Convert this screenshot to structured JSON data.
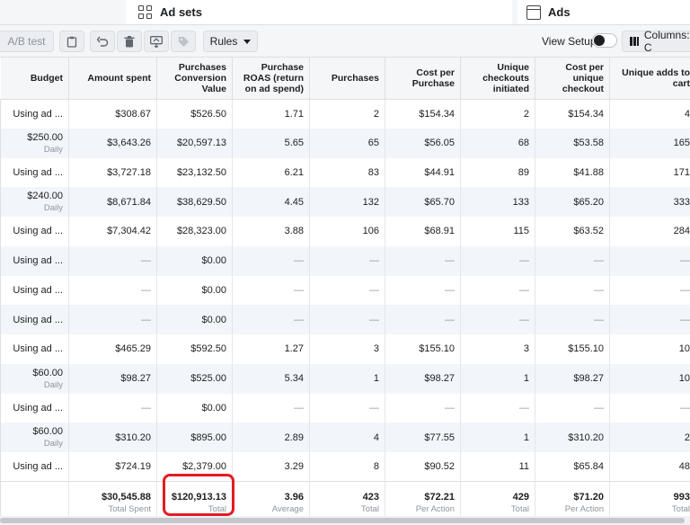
{
  "tabs": {
    "adsets": "Ad sets",
    "ads": "Ads"
  },
  "toolbar": {
    "ab_test": "A/B test",
    "rules": "Rules",
    "view_setup": "View Setup",
    "columns": "Columns: C"
  },
  "columns": [
    "Budget",
    "Amount spent",
    "Purchases Conversion Value",
    "Purchase ROAS (return on ad spend)",
    "Purchases",
    "Cost per Purchase",
    "Unique checkouts initiated",
    "Cost per unique checkout",
    "Unique adds to cart"
  ],
  "rows": [
    {
      "budget": "Using ad ...",
      "budget_sub": "",
      "amount": "$308.67",
      "value": "$526.50",
      "roas": "1.71",
      "purchases": "2",
      "cpp": "$154.34",
      "checkouts": "2",
      "cpc": "$154.34",
      "adds": "4"
    },
    {
      "budget": "$250.00",
      "budget_sub": "Daily",
      "amount": "$3,643.26",
      "value": "$20,597.13",
      "roas": "5.65",
      "purchases": "65",
      "cpp": "$56.05",
      "checkouts": "68",
      "cpc": "$53.58",
      "adds": "165"
    },
    {
      "budget": "Using ad ...",
      "budget_sub": "",
      "amount": "$3,727.18",
      "value": "$23,132.50",
      "roas": "6.21",
      "purchases": "83",
      "cpp": "$44.91",
      "checkouts": "89",
      "cpc": "$41.88",
      "adds": "171"
    },
    {
      "budget": "$240.00",
      "budget_sub": "Daily",
      "amount": "$8,671.84",
      "value": "$38,629.50",
      "roas": "4.45",
      "purchases": "132",
      "cpp": "$65.70",
      "checkouts": "133",
      "cpc": "$65.20",
      "adds": "333"
    },
    {
      "budget": "Using ad ...",
      "budget_sub": "",
      "amount": "$7,304.42",
      "value": "$28,323.00",
      "roas": "3.88",
      "purchases": "106",
      "cpp": "$68.91",
      "checkouts": "115",
      "cpc": "$63.52",
      "adds": "284"
    },
    {
      "budget": "Using ad ...",
      "budget_sub": "",
      "amount": "—",
      "value": "$0.00",
      "roas": "—",
      "purchases": "—",
      "cpp": "—",
      "checkouts": "—",
      "cpc": "—",
      "adds": "—"
    },
    {
      "budget": "Using ad ...",
      "budget_sub": "",
      "amount": "—",
      "value": "$0.00",
      "roas": "—",
      "purchases": "—",
      "cpp": "—",
      "checkouts": "—",
      "cpc": "—",
      "adds": "—"
    },
    {
      "budget": "Using ad ...",
      "budget_sub": "",
      "amount": "—",
      "value": "$0.00",
      "roas": "—",
      "purchases": "—",
      "cpp": "—",
      "checkouts": "—",
      "cpc": "—",
      "adds": "—"
    },
    {
      "budget": "Using ad ...",
      "budget_sub": "",
      "amount": "$465.29",
      "value": "$592.50",
      "roas": "1.27",
      "purchases": "3",
      "cpp": "$155.10",
      "checkouts": "3",
      "cpc": "$155.10",
      "adds": "10"
    },
    {
      "budget": "$60.00",
      "budget_sub": "Daily",
      "amount": "$98.27",
      "value": "$525.00",
      "roas": "5.34",
      "purchases": "1",
      "cpp": "$98.27",
      "checkouts": "1",
      "cpc": "$98.27",
      "adds": "10"
    },
    {
      "budget": "Using ad ...",
      "budget_sub": "",
      "amount": "—",
      "value": "$0.00",
      "roas": "—",
      "purchases": "—",
      "cpp": "—",
      "checkouts": "—",
      "cpc": "—",
      "adds": "—"
    },
    {
      "budget": "$60.00",
      "budget_sub": "Daily",
      "amount": "$310.20",
      "value": "$895.00",
      "roas": "2.89",
      "purchases": "4",
      "cpp": "$77.55",
      "checkouts": "1",
      "cpc": "$310.20",
      "adds": "2"
    },
    {
      "budget": "Using ad ...",
      "budget_sub": "",
      "amount": "$724.19",
      "value": "$2,379.00",
      "roas": "3.29",
      "purchases": "8",
      "cpp": "$90.52",
      "checkouts": "11",
      "cpc": "$65.84",
      "adds": "48"
    }
  ],
  "totals": {
    "amount": "$30,545.88",
    "amount_sub": "Total Spent",
    "value": "$120,913.13",
    "value_sub": "Total",
    "roas": "3.96",
    "roas_sub": "Average",
    "purchases": "423",
    "purchases_sub": "Total",
    "cpp": "$72.21",
    "cpp_sub": "Per Action",
    "checkouts": "429",
    "checkouts_sub": "Total",
    "cpc": "$71.20",
    "cpc_sub": "Per Action",
    "adds": "993",
    "adds_sub": "Total"
  },
  "highlight_color": "#e41c22"
}
